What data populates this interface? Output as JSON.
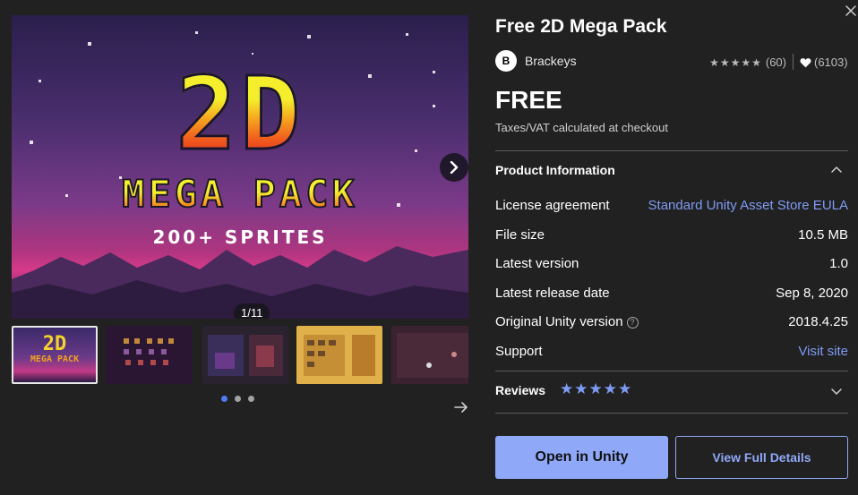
{
  "gallery": {
    "hero_line1": "2D",
    "hero_line2": "MEGA PACK",
    "hero_line3": "200+ SPRITES",
    "counter": "1/11",
    "thumb1_line1": "2D",
    "thumb1_line2": "MEGA PACK",
    "dots_count": 3,
    "active_dot": 1
  },
  "product": {
    "title": "Free 2D Mega Pack",
    "publisher_initial": "B",
    "publisher": "Brackeys",
    "rating_count": "(60)",
    "favorites": "(6103)",
    "price": "FREE",
    "tax_note": "Taxes/VAT calculated at checkout"
  },
  "info": {
    "heading": "Product Information",
    "rows": [
      {
        "label": "License agreement",
        "value": "Standard Unity Asset Store EULA"
      },
      {
        "label": "File size",
        "value": "10.5 MB"
      },
      {
        "label": "Latest version",
        "value": "1.0"
      },
      {
        "label": "Latest release date",
        "value": "Sep 8, 2020"
      },
      {
        "label": "Original Unity version",
        "value": "2018.4.25"
      },
      {
        "label": "Support",
        "value": "Visit site"
      }
    ]
  },
  "reviews": {
    "label": "Reviews",
    "stars": "★★★★★"
  },
  "actions": {
    "open_label": "Open in Unity",
    "details_label": "View Full Details"
  },
  "colors": {
    "accent": "#8fa8f8",
    "link": "#7f9cf5",
    "background": "#212121"
  }
}
